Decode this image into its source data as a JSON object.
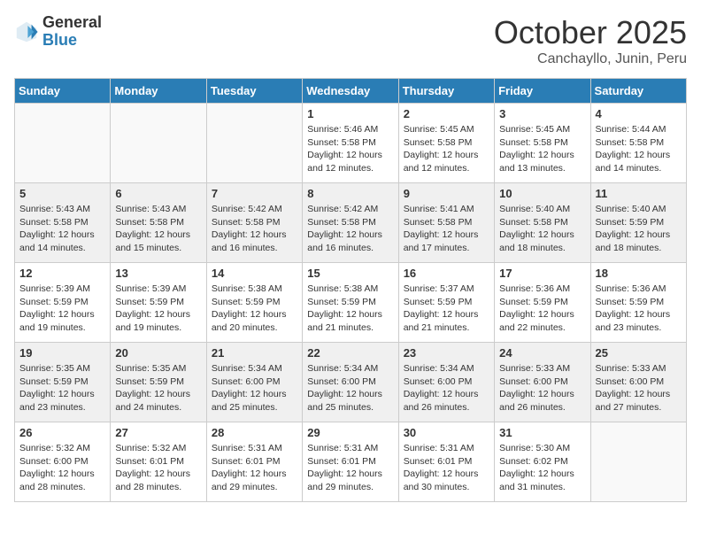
{
  "logo": {
    "general": "General",
    "blue": "Blue"
  },
  "header": {
    "month": "October 2025",
    "location": "Canchayllo, Junin, Peru"
  },
  "days_of_week": [
    "Sunday",
    "Monday",
    "Tuesday",
    "Wednesday",
    "Thursday",
    "Friday",
    "Saturday"
  ],
  "weeks": [
    [
      {
        "num": "",
        "info": ""
      },
      {
        "num": "",
        "info": ""
      },
      {
        "num": "",
        "info": ""
      },
      {
        "num": "1",
        "info": "Sunrise: 5:46 AM\nSunset: 5:58 PM\nDaylight: 12 hours\nand 12 minutes."
      },
      {
        "num": "2",
        "info": "Sunrise: 5:45 AM\nSunset: 5:58 PM\nDaylight: 12 hours\nand 12 minutes."
      },
      {
        "num": "3",
        "info": "Sunrise: 5:45 AM\nSunset: 5:58 PM\nDaylight: 12 hours\nand 13 minutes."
      },
      {
        "num": "4",
        "info": "Sunrise: 5:44 AM\nSunset: 5:58 PM\nDaylight: 12 hours\nand 14 minutes."
      }
    ],
    [
      {
        "num": "5",
        "info": "Sunrise: 5:43 AM\nSunset: 5:58 PM\nDaylight: 12 hours\nand 14 minutes."
      },
      {
        "num": "6",
        "info": "Sunrise: 5:43 AM\nSunset: 5:58 PM\nDaylight: 12 hours\nand 15 minutes."
      },
      {
        "num": "7",
        "info": "Sunrise: 5:42 AM\nSunset: 5:58 PM\nDaylight: 12 hours\nand 16 minutes."
      },
      {
        "num": "8",
        "info": "Sunrise: 5:42 AM\nSunset: 5:58 PM\nDaylight: 12 hours\nand 16 minutes."
      },
      {
        "num": "9",
        "info": "Sunrise: 5:41 AM\nSunset: 5:58 PM\nDaylight: 12 hours\nand 17 minutes."
      },
      {
        "num": "10",
        "info": "Sunrise: 5:40 AM\nSunset: 5:58 PM\nDaylight: 12 hours\nand 18 minutes."
      },
      {
        "num": "11",
        "info": "Sunrise: 5:40 AM\nSunset: 5:59 PM\nDaylight: 12 hours\nand 18 minutes."
      }
    ],
    [
      {
        "num": "12",
        "info": "Sunrise: 5:39 AM\nSunset: 5:59 PM\nDaylight: 12 hours\nand 19 minutes."
      },
      {
        "num": "13",
        "info": "Sunrise: 5:39 AM\nSunset: 5:59 PM\nDaylight: 12 hours\nand 19 minutes."
      },
      {
        "num": "14",
        "info": "Sunrise: 5:38 AM\nSunset: 5:59 PM\nDaylight: 12 hours\nand 20 minutes."
      },
      {
        "num": "15",
        "info": "Sunrise: 5:38 AM\nSunset: 5:59 PM\nDaylight: 12 hours\nand 21 minutes."
      },
      {
        "num": "16",
        "info": "Sunrise: 5:37 AM\nSunset: 5:59 PM\nDaylight: 12 hours\nand 21 minutes."
      },
      {
        "num": "17",
        "info": "Sunrise: 5:36 AM\nSunset: 5:59 PM\nDaylight: 12 hours\nand 22 minutes."
      },
      {
        "num": "18",
        "info": "Sunrise: 5:36 AM\nSunset: 5:59 PM\nDaylight: 12 hours\nand 23 minutes."
      }
    ],
    [
      {
        "num": "19",
        "info": "Sunrise: 5:35 AM\nSunset: 5:59 PM\nDaylight: 12 hours\nand 23 minutes."
      },
      {
        "num": "20",
        "info": "Sunrise: 5:35 AM\nSunset: 5:59 PM\nDaylight: 12 hours\nand 24 minutes."
      },
      {
        "num": "21",
        "info": "Sunrise: 5:34 AM\nSunset: 6:00 PM\nDaylight: 12 hours\nand 25 minutes."
      },
      {
        "num": "22",
        "info": "Sunrise: 5:34 AM\nSunset: 6:00 PM\nDaylight: 12 hours\nand 25 minutes."
      },
      {
        "num": "23",
        "info": "Sunrise: 5:34 AM\nSunset: 6:00 PM\nDaylight: 12 hours\nand 26 minutes."
      },
      {
        "num": "24",
        "info": "Sunrise: 5:33 AM\nSunset: 6:00 PM\nDaylight: 12 hours\nand 26 minutes."
      },
      {
        "num": "25",
        "info": "Sunrise: 5:33 AM\nSunset: 6:00 PM\nDaylight: 12 hours\nand 27 minutes."
      }
    ],
    [
      {
        "num": "26",
        "info": "Sunrise: 5:32 AM\nSunset: 6:00 PM\nDaylight: 12 hours\nand 28 minutes."
      },
      {
        "num": "27",
        "info": "Sunrise: 5:32 AM\nSunset: 6:01 PM\nDaylight: 12 hours\nand 28 minutes."
      },
      {
        "num": "28",
        "info": "Sunrise: 5:31 AM\nSunset: 6:01 PM\nDaylight: 12 hours\nand 29 minutes."
      },
      {
        "num": "29",
        "info": "Sunrise: 5:31 AM\nSunset: 6:01 PM\nDaylight: 12 hours\nand 29 minutes."
      },
      {
        "num": "30",
        "info": "Sunrise: 5:31 AM\nSunset: 6:01 PM\nDaylight: 12 hours\nand 30 minutes."
      },
      {
        "num": "31",
        "info": "Sunrise: 5:30 AM\nSunset: 6:02 PM\nDaylight: 12 hours\nand 31 minutes."
      },
      {
        "num": "",
        "info": ""
      }
    ]
  ]
}
